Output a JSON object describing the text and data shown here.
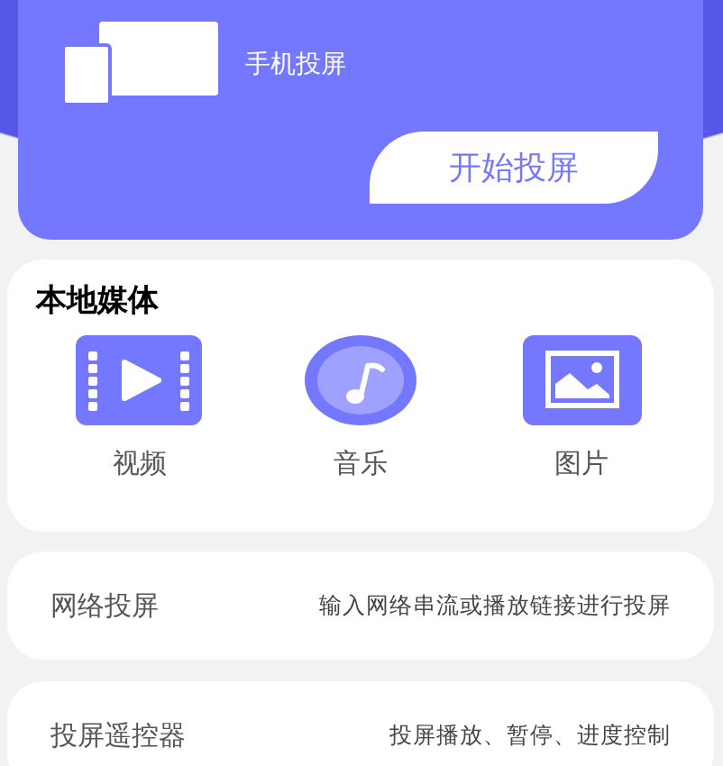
{
  "hero": {
    "title": "手机投屏",
    "button": "开始投屏"
  },
  "local_media": {
    "title": "本地媒体",
    "items": [
      {
        "kind": "video",
        "label": "视频"
      },
      {
        "kind": "music",
        "label": "音乐"
      },
      {
        "kind": "image",
        "label": "图片"
      }
    ]
  },
  "features": [
    {
      "title": "网络投屏",
      "description": "输入网络串流或播放链接进行投屏"
    },
    {
      "title": "投屏遥控器",
      "description": "投屏播放、暂停、进度控制"
    }
  ]
}
